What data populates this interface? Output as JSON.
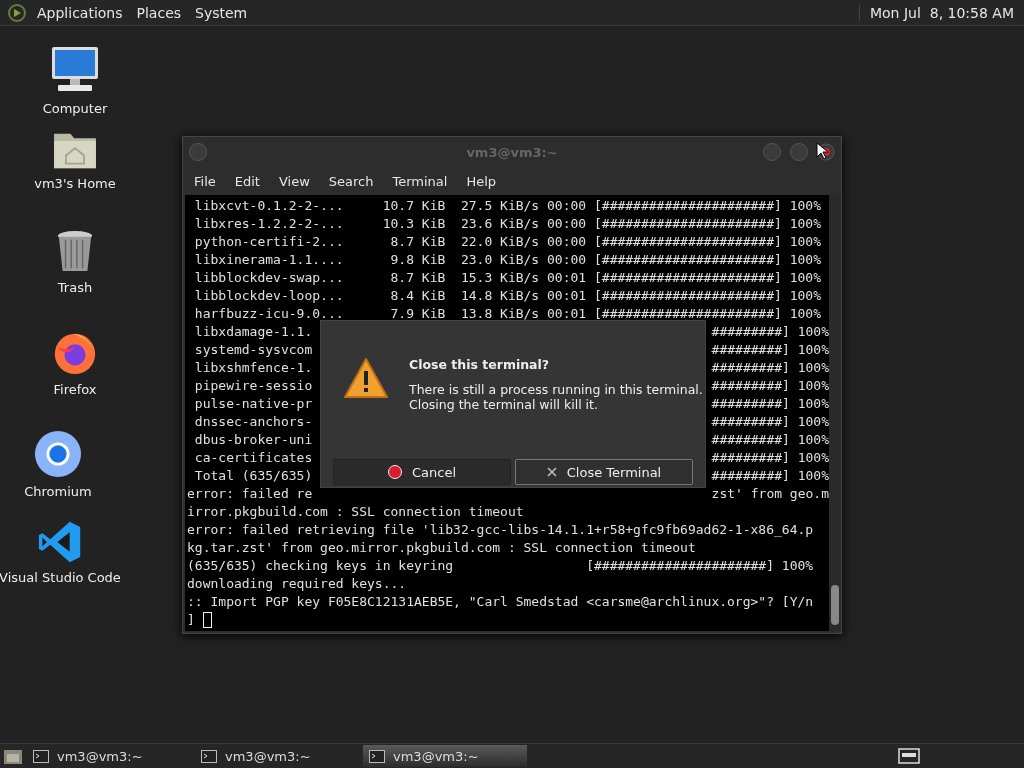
{
  "top_panel": {
    "menus": [
      "Applications",
      "Places",
      "System"
    ],
    "clock": "Mon Jul  8, 10:58 AM"
  },
  "desktop_icons": [
    {
      "kind": "computer",
      "label": "Computer"
    },
    {
      "kind": "home",
      "label": "vm3's Home"
    },
    {
      "kind": "trash",
      "label": "Trash"
    },
    {
      "kind": "firefox",
      "label": "Firefox"
    },
    {
      "kind": "chromium",
      "label": "Chromium"
    },
    {
      "kind": "vscode",
      "label": "Visual Studio Code"
    }
  ],
  "terminal": {
    "title": "vm3@vm3:~",
    "menu": [
      "File",
      "Edit",
      "View",
      "Search",
      "Terminal",
      "Help"
    ],
    "lines": [
      {
        "text": " libxcvt-0.1.2-2-...     10.7 KiB  27.5 KiB/s 00:00 [######################] 100%"
      },
      {
        "text": " libxres-1.2.2-2-...     10.3 KiB  23.6 KiB/s 00:00 [######################] 100%"
      },
      {
        "text": " python-certifi-2...      8.7 KiB  22.0 KiB/s 00:00 [######################] 100%"
      },
      {
        "text": " libxinerama-1.1....      9.8 KiB  23.0 KiB/s 00:00 [######################] 100%"
      },
      {
        "text": " libblockdev-swap...      8.7 KiB  15.3 KiB/s 00:01 [######################] 100%"
      },
      {
        "text": " libblockdev-loop...      8.4 KiB  14.8 KiB/s 00:01 [######################] 100%"
      },
      {
        "text": " harfbuzz-icu-9.0...      7.9 KiB  13.8 KiB/s 00:01 [######################] 100%"
      },
      {
        "left": " libxdamage-1.1.",
        "right": "#########] 100%"
      },
      {
        "left": " systemd-sysvcom",
        "right": "#########] 100%"
      },
      {
        "left": " libxshmfence-1.",
        "right": "#########] 100%"
      },
      {
        "left": " pipewire-sessio",
        "right": "#########] 100%"
      },
      {
        "left": " pulse-native-pr",
        "right": "#########] 100%"
      },
      {
        "left": " dnssec-anchors-",
        "right": "#########] 100%"
      },
      {
        "left": " dbus-broker-uni",
        "right": "#########] 100%"
      },
      {
        "left": " ca-certificates",
        "right": "#########] 100%"
      },
      {
        "left": " Total (635/635)",
        "right": "#########] 100%"
      },
      {
        "left": "error: failed re",
        "right": "zst' from geo.m"
      },
      {
        "text": "irror.pkgbuild.com : SSL connection timeout"
      },
      {
        "text": "error: failed retrieving file 'lib32-gcc-libs-14.1.1+r58+gfc9fb69ad62-1-x86_64.p"
      },
      {
        "text": "kg.tar.zst' from geo.mirror.pkgbuild.com : SSL connection timeout"
      },
      {
        "text": "(635/635) checking keys in keyring                 [######################] 100%"
      },
      {
        "text": "downloading required keys..."
      },
      {
        "text": ":: Import PGP key F05E8C12131AEB5E, \"Carl Smedstad <carsme@archlinux.org>\"? [Y/n"
      },
      {
        "text": "]",
        "cursor": true
      }
    ]
  },
  "dialog": {
    "title": "Close this terminal?",
    "message_lines": [
      "There is still a process running in this terminal.",
      "Closing the terminal will kill it."
    ],
    "buttons": [
      {
        "kind": "cancel",
        "label": "Cancel",
        "focused": false
      },
      {
        "kind": "close",
        "label": "Close Terminal",
        "focused": true
      }
    ]
  },
  "taskbar": {
    "tasks": [
      {
        "label": "vm3@vm3:~",
        "selected": false
      },
      {
        "label": "vm3@vm3:~",
        "selected": false
      },
      {
        "label": "vm3@vm3:~",
        "selected": true
      }
    ]
  }
}
